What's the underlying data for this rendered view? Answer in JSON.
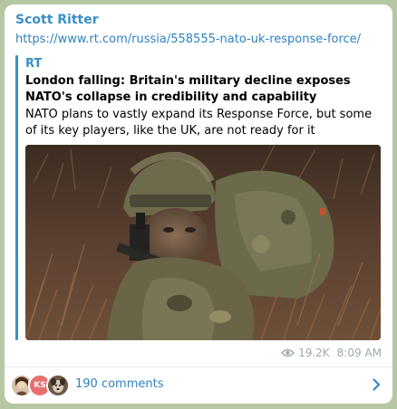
{
  "post": {
    "author": "Scott Ritter",
    "link": "https://www.rt.com/russia/558555-nato-uk-response-force/"
  },
  "preview": {
    "site_name": "RT",
    "title": "London falling: Britain's military decline exposes NATO's collapse in credibility and capability",
    "description": "NATO plans to vastly expand its Response Force, but some of its key players, like the UK, are not ready for it",
    "image_icon": "soldier-photo"
  },
  "meta": {
    "views": "19.2K",
    "time": "8:09 AM"
  },
  "comments": {
    "label": "190 comments",
    "avatars": [
      "person-photo",
      "KS",
      "dog-photo"
    ]
  },
  "colors": {
    "accent": "#3a8fc7",
    "link": "#2f82c0",
    "background": "#b7c7a4"
  }
}
